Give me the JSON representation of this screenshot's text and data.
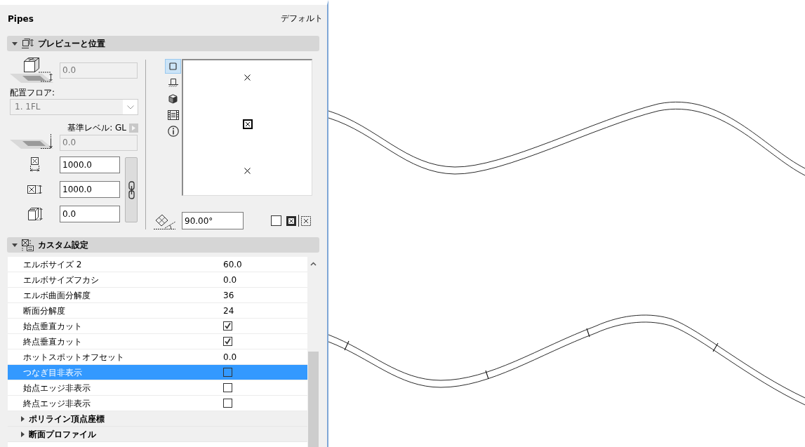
{
  "panel": {
    "title": "Pipes",
    "preset": "デフォルト"
  },
  "preview_section": {
    "title": "プレビューと位置",
    "expanded": true,
    "elevation": {
      "value": "0.0",
      "disabled": true
    },
    "floor_label": "配置フロア:",
    "floor": {
      "value": "1. 1FL",
      "disabled": true
    },
    "reference_level": "基準レベル: GL",
    "level_offset": {
      "value": "0.0",
      "disabled": true
    },
    "size_fields": [
      {
        "kind": "width",
        "value": "1000.0",
        "disabled": false
      },
      {
        "kind": "depth",
        "value": "1000.0",
        "disabled": false
      },
      {
        "kind": "height",
        "value": "0.0",
        "disabled": false
      }
    ],
    "view_modes": [
      {
        "kind": "square",
        "selected": true
      },
      {
        "kind": "floor",
        "selected": false
      },
      {
        "kind": "cube",
        "selected": false
      },
      {
        "kind": "film",
        "selected": false
      },
      {
        "kind": "info",
        "selected": false
      }
    ],
    "angle": {
      "value": "90.00°",
      "disabled": false
    }
  },
  "custom_section": {
    "title": "カスタム設定",
    "expanded": true,
    "rows": [
      {
        "kind": "value",
        "label": "エルボサイズ 2",
        "value": "60.0",
        "selected": false
      },
      {
        "kind": "value",
        "label": "エルボサイズフカシ",
        "value": "0.0",
        "selected": false
      },
      {
        "kind": "value",
        "label": "エルボ曲面分解度",
        "value": "36",
        "selected": false
      },
      {
        "kind": "value",
        "label": "断面分解度",
        "value": "24",
        "selected": false
      },
      {
        "kind": "checkbox",
        "label": "始点垂直カット",
        "checked": true,
        "selected": false
      },
      {
        "kind": "checkbox",
        "label": "終点垂直カット",
        "checked": true,
        "selected": false
      },
      {
        "kind": "value",
        "label": "ホットスポットオフセット",
        "value": "0.0",
        "selected": false
      },
      {
        "kind": "checkbox",
        "label": "つなぎ目非表示",
        "checked": false,
        "selected": true
      },
      {
        "kind": "checkbox",
        "label": "始点エッジ非表示",
        "checked": false,
        "selected": false
      },
      {
        "kind": "checkbox",
        "label": "終点エッジ非表示",
        "checked": false,
        "selected": false
      },
      {
        "kind": "group",
        "label": "ポリライン頂点座標",
        "expanded": false,
        "selected": false
      },
      {
        "kind": "group",
        "label": "断面プロファイル",
        "expanded": false,
        "selected": false
      }
    ]
  }
}
